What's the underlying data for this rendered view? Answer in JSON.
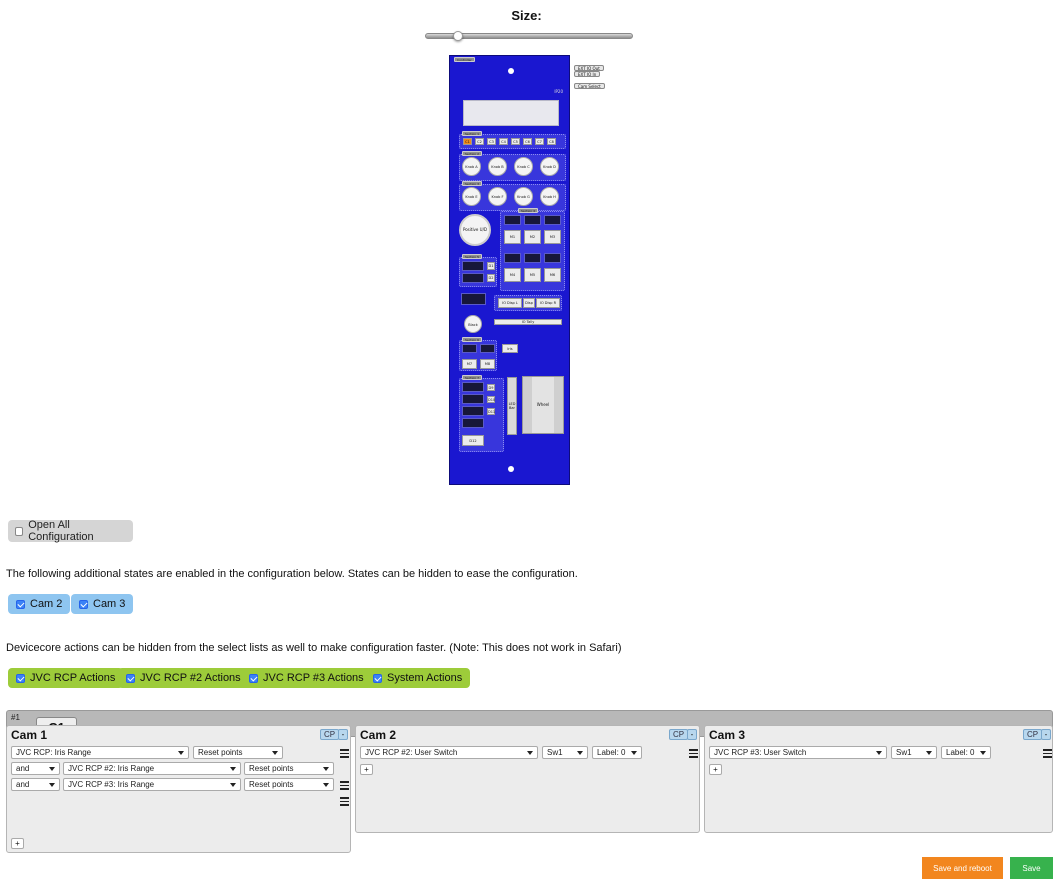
{
  "size": {
    "label": "Size:",
    "slider_fraction": 0.14
  },
  "device": {
    "top_tag": "Controller",
    "model": "IP20",
    "side_tags": [
      "EXT IO Out",
      "EXT IO In",
      "Cam Select"
    ],
    "section_labels": [
      "Section 1",
      "Section 2",
      "Section 3",
      "Section 4",
      "Section 5",
      "Section 6",
      "Section 7"
    ],
    "cam_buttons": [
      "C1",
      "C2",
      "C3",
      "C4",
      "C5",
      "C6",
      "C7",
      "C8"
    ],
    "knobs_row1": [
      "Knob A",
      "Knob B",
      "Knob C",
      "Knob D"
    ],
    "knobs_row2": [
      "Knob E",
      "Knob F",
      "Knob G",
      "Knob H"
    ],
    "positive_knob": "Positive U/D",
    "m_buttons_top": [
      "M1",
      "M2",
      "M3"
    ],
    "m_buttons_bottom": [
      "M4",
      "M5",
      "M6"
    ],
    "section5_buttons": [
      "D1",
      "D2"
    ],
    "io_buttons": [
      "IO Disp L",
      "Disp",
      "IO Disp R"
    ],
    "black_button": "Black",
    "io_tally": "IO Tally",
    "iris_button": "Iris",
    "m7_m8": [
      "M7",
      "M8"
    ],
    "section7_buttons": [
      "D9",
      "D10",
      "D11"
    ],
    "d12_button": "D12",
    "led_bar": "LED Bar",
    "wheel": "Wheel"
  },
  "open_all": {
    "label": "Open All Configuration",
    "checked": false
  },
  "states_text": "The following additional states are enabled in the configuration below. States can be hidden to ease the configuration.",
  "states": [
    {
      "label": "Cam 2",
      "checked": true
    },
    {
      "label": "Cam 3",
      "checked": true
    }
  ],
  "actions_text": "Devicecore actions can be hidden from the select lists as well to make configuration faster. (Note: This does not work in Safari)",
  "action_groups": [
    {
      "label": "JVC RCP Actions",
      "checked": true
    },
    {
      "label": "JVC RCP #2 Actions",
      "checked": true
    },
    {
      "label": "JVC RCP #3 Actions",
      "checked": true
    },
    {
      "label": "System Actions",
      "checked": true
    }
  ],
  "button_config": {
    "number": "#1",
    "label": "C1"
  },
  "cams": [
    {
      "title": "Cam 1",
      "cp": "CP",
      "minus": "-",
      "row1": {
        "action": "JVC RCP: Iris Range",
        "param": "Reset points"
      },
      "row2": {
        "join": "and",
        "action": "JVC RCP #2: Iris Range",
        "param": "Reset points"
      },
      "row3": {
        "join": "and",
        "action": "JVC RCP #3: Iris Range",
        "param": "Reset points"
      },
      "plus": "+"
    },
    {
      "title": "Cam 2",
      "cp": "CP",
      "minus": "-",
      "row1": {
        "action": "JVC RCP #2: User Switch",
        "param": "Sw1",
        "label": "Label: 0"
      },
      "plus": "+"
    },
    {
      "title": "Cam 3",
      "cp": "CP",
      "minus": "-",
      "row1": {
        "action": "JVC RCP #3: User Switch",
        "param": "Sw1",
        "label": "Label: 0"
      },
      "plus": "+"
    }
  ],
  "footer": {
    "save_reboot": "Save and reboot",
    "save": "Save"
  },
  "colors": {
    "panel": "#1a17d0",
    "active_cam": "#f28b1b",
    "pill_blue": "#8ec5f0",
    "pill_green": "#9dcc3a",
    "save_reboot": "#f2861e",
    "save": "#37b24d"
  }
}
